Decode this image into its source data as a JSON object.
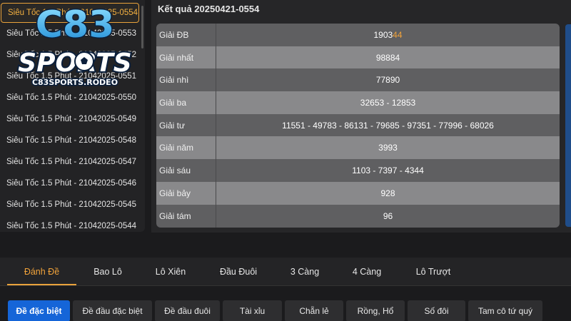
{
  "draws": [
    {
      "label": "Siêu Tốc 1.5 Phút - 21042025-0554",
      "active": true
    },
    {
      "label": "Siêu Tốc 1.5 Phút - 21042025-0553"
    },
    {
      "label": "Siêu Tốc 1.5 Phút - 21042025-0552"
    },
    {
      "label": "Siêu Tốc 1.5 Phút - 21042025-0551"
    },
    {
      "label": "Siêu Tốc 1.5 Phút - 21042025-0550"
    },
    {
      "label": "Siêu Tốc 1.5 Phút - 21042025-0549"
    },
    {
      "label": "Siêu Tốc 1.5 Phút - 21042025-0548"
    },
    {
      "label": "Siêu Tốc 1.5 Phút - 21042025-0547"
    },
    {
      "label": "Siêu Tốc 1.5 Phút - 21042025-0546"
    },
    {
      "label": "Siêu Tốc 1.5 Phút - 21042025-0545"
    },
    {
      "label": "Siêu Tốc 1.5 Phút - 21042025-0544"
    }
  ],
  "logo": {
    "main": "C83",
    "sub": "SPORTS",
    "domain": "C83SPORTS.RODEO"
  },
  "result": {
    "title": "Kết quả  20250421-0554",
    "prizes": [
      {
        "name": "Giải ĐB",
        "value": "190344"
      },
      {
        "name": "Giải nhất",
        "value": "98884"
      },
      {
        "name": "Giải nhì",
        "value": "77890"
      },
      {
        "name": "Giải ba",
        "value": "32653 - 12853"
      },
      {
        "name": "Giải tư",
        "value": "11551 - 49783 - 86131 - 79685 - 97351 - 77996 - 68026"
      },
      {
        "name": "Giải năm",
        "value": "3993"
      },
      {
        "name": "Giải sáu",
        "value": "1103 - 7397 - 4344"
      },
      {
        "name": "Giải bảy",
        "value": "928"
      },
      {
        "name": "Giải tám",
        "value": "96"
      }
    ]
  },
  "special_prize_parts": {
    "plain": "1903",
    "highlight": "44"
  },
  "tabs": [
    "Đánh Đề",
    "Bao Lô",
    "Lô Xiên",
    "Đầu Đuôi",
    "3 Càng",
    "4 Càng",
    "Lô Trượt"
  ],
  "subtabs": [
    "Đề đặc biệt",
    "Đề đầu đặc biệt",
    "Đề đầu đuôi",
    "Tài xỉu",
    "Chẵn lẻ",
    "Rồng, Hổ",
    "Số đôi",
    "Tam cô tứ quý"
  ],
  "colors": {
    "accent": "#e9a23b",
    "active_subtab": "#1565d8"
  }
}
